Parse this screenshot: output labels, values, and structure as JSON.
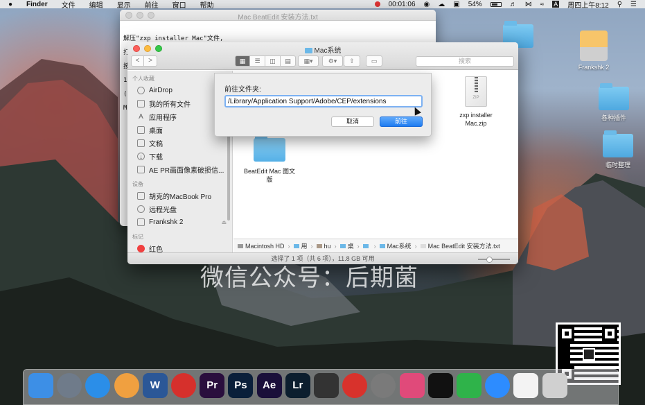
{
  "menubar": {
    "apple": "",
    "app_name": "Finder",
    "menus": [
      "文件",
      "编辑",
      "显示",
      "前往",
      "窗口",
      "帮助"
    ],
    "timer": "00:01:06",
    "battery": "54%",
    "input_method": "A",
    "clock": "周四上午8:12"
  },
  "desktop_icons": [
    {
      "label": "",
      "kind": "folder"
    },
    {
      "label": "Frankshk 2",
      "kind": "drive"
    },
    {
      "label": "各种插件",
      "kind": "folder"
    },
    {
      "label": "临时整理",
      "kind": "folder"
    }
  ],
  "text_window": {
    "title": "Mac BeatEdit 安装方法.txt",
    "lines": [
      "解压\"zxp installer Mac\"文件,",
      "打",
      "按",
      "",
      "1",
      "(",
      "",
      "M"
    ]
  },
  "finder": {
    "title": "Mac系统",
    "nav": {
      "back": "<",
      "forward": ">"
    },
    "search_placeholder": "搜索",
    "sidebar": {
      "favorites_header": "个人收藏",
      "favorites": [
        {
          "label": "AirDrop",
          "icon": "airdrop-icon"
        },
        {
          "label": "我的所有文件",
          "icon": "all-files-icon"
        },
        {
          "label": "应用程序",
          "icon": "applications-icon"
        },
        {
          "label": "桌面",
          "icon": "desktop-icon"
        },
        {
          "label": "文稿",
          "icon": "documents-icon"
        },
        {
          "label": "下载",
          "icon": "downloads-icon"
        },
        {
          "label": "AE PR画面像素破损信...",
          "icon": "folder-icon"
        }
      ],
      "devices_header": "设备",
      "devices": [
        {
          "label": "胡克的MacBook Pro",
          "icon": "laptop-icon"
        },
        {
          "label": "远程光盘",
          "icon": "disc-icon"
        },
        {
          "label": "Frankshk 2",
          "icon": "drive-icon"
        }
      ],
      "tags_header": "标记",
      "tags": [
        {
          "label": "红色",
          "color": "#f04040"
        }
      ]
    },
    "files": [
      {
        "name": "zxp installer Mac.zip",
        "line1": "zxp installer",
        "line2": "Mac.zip",
        "type": "zip",
        "badge": "ZIP"
      },
      {
        "name": "BeatEdit Mac 图文版",
        "line1": "BeatEdit Mac 图文",
        "line2": "版",
        "type": "folder"
      }
    ],
    "pathbar": [
      "Macintosh HD",
      "用",
      "hu",
      "桌",
      "",
      "Mac系统",
      "Mac BeatEdit 安装方法.txt"
    ],
    "status": "选择了 1 项（共 6 项），11.8 GB 可用"
  },
  "goto_sheet": {
    "label": "前往文件夹:",
    "value": "/Library/Application Support/Adobe/CEP/extensions",
    "cancel_label": "取消",
    "go_label": "前往"
  },
  "watermark": "微信公众号：后期菌",
  "dock": [
    {
      "name": "finder",
      "label": "",
      "color": "#3d8fe6"
    },
    {
      "name": "launchpad",
      "label": "",
      "color": "#6f7b8a"
    },
    {
      "name": "safari",
      "label": "",
      "color": "#2b8ee8"
    },
    {
      "name": "photos",
      "label": "",
      "color": "#f0a040"
    },
    {
      "name": "word",
      "label": "W",
      "color": "#2b5797"
    },
    {
      "name": "player",
      "label": "",
      "color": "#d6302c"
    },
    {
      "name": "premiere",
      "label": "Pr",
      "color": "#2a0e3d"
    },
    {
      "name": "photoshop",
      "label": "Ps",
      "color": "#0a1f3a"
    },
    {
      "name": "after-effects",
      "label": "Ae",
      "color": "#1a0f3a"
    },
    {
      "name": "lightroom",
      "label": "Lr",
      "color": "#0c1e2e"
    },
    {
      "name": "final-cut",
      "label": "",
      "color": "#333333"
    },
    {
      "name": "netease-music",
      "label": "",
      "color": "#d8322c"
    },
    {
      "name": "system-prefs",
      "label": "",
      "color": "#7a7a7a"
    },
    {
      "name": "cleanmymac",
      "label": "",
      "color": "#e04a7a"
    },
    {
      "name": "qq",
      "label": "",
      "color": "#111111"
    },
    {
      "name": "wechat",
      "label": "",
      "color": "#2fb34a"
    },
    {
      "name": "zoom",
      "label": "",
      "color": "#2d8cff"
    },
    {
      "name": "notes",
      "label": "",
      "color": "#f3f3f3"
    },
    {
      "name": "trash",
      "label": "",
      "color": "#d0d0d0"
    }
  ]
}
